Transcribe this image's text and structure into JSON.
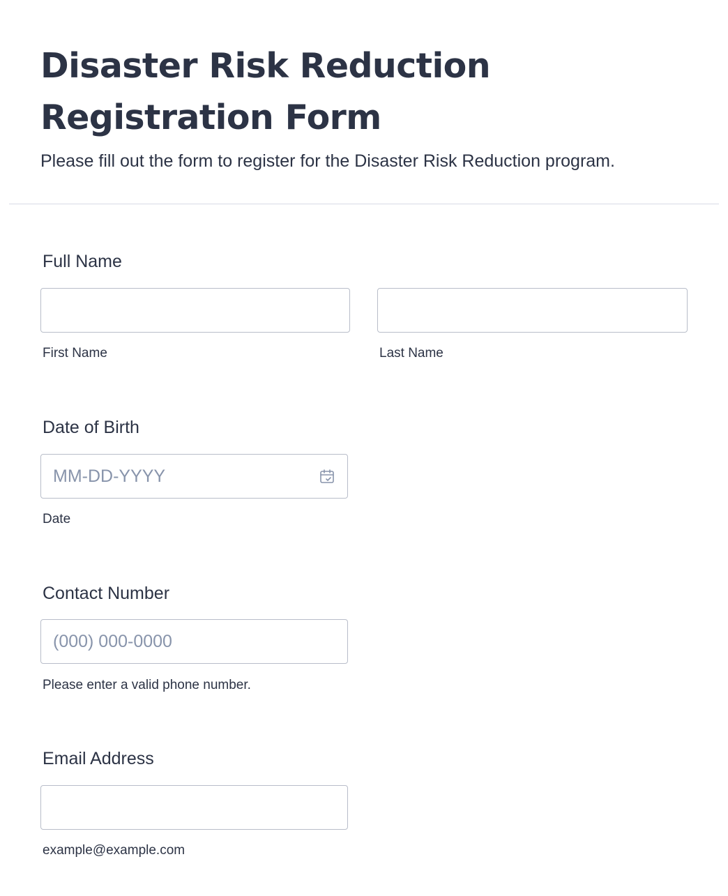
{
  "form": {
    "title": "Disaster Risk Reduction Registration Form",
    "subtitle": "Please fill out the form to register for the Disaster Risk Reduction program."
  },
  "fields": {
    "full_name": {
      "label": "Full Name",
      "first_value": "",
      "first_sublabel": "First Name",
      "last_value": "",
      "last_sublabel": "Last Name"
    },
    "date_of_birth": {
      "label": "Date of Birth",
      "placeholder": "MM-DD-YYYY",
      "sublabel": "Date",
      "icon": "calendar-icon"
    },
    "contact_number": {
      "label": "Contact Number",
      "placeholder": "(000) 000-0000",
      "sublabel": "Please enter a valid phone number."
    },
    "email": {
      "label": "Email Address",
      "value": "",
      "sublabel": "example@example.com"
    }
  }
}
